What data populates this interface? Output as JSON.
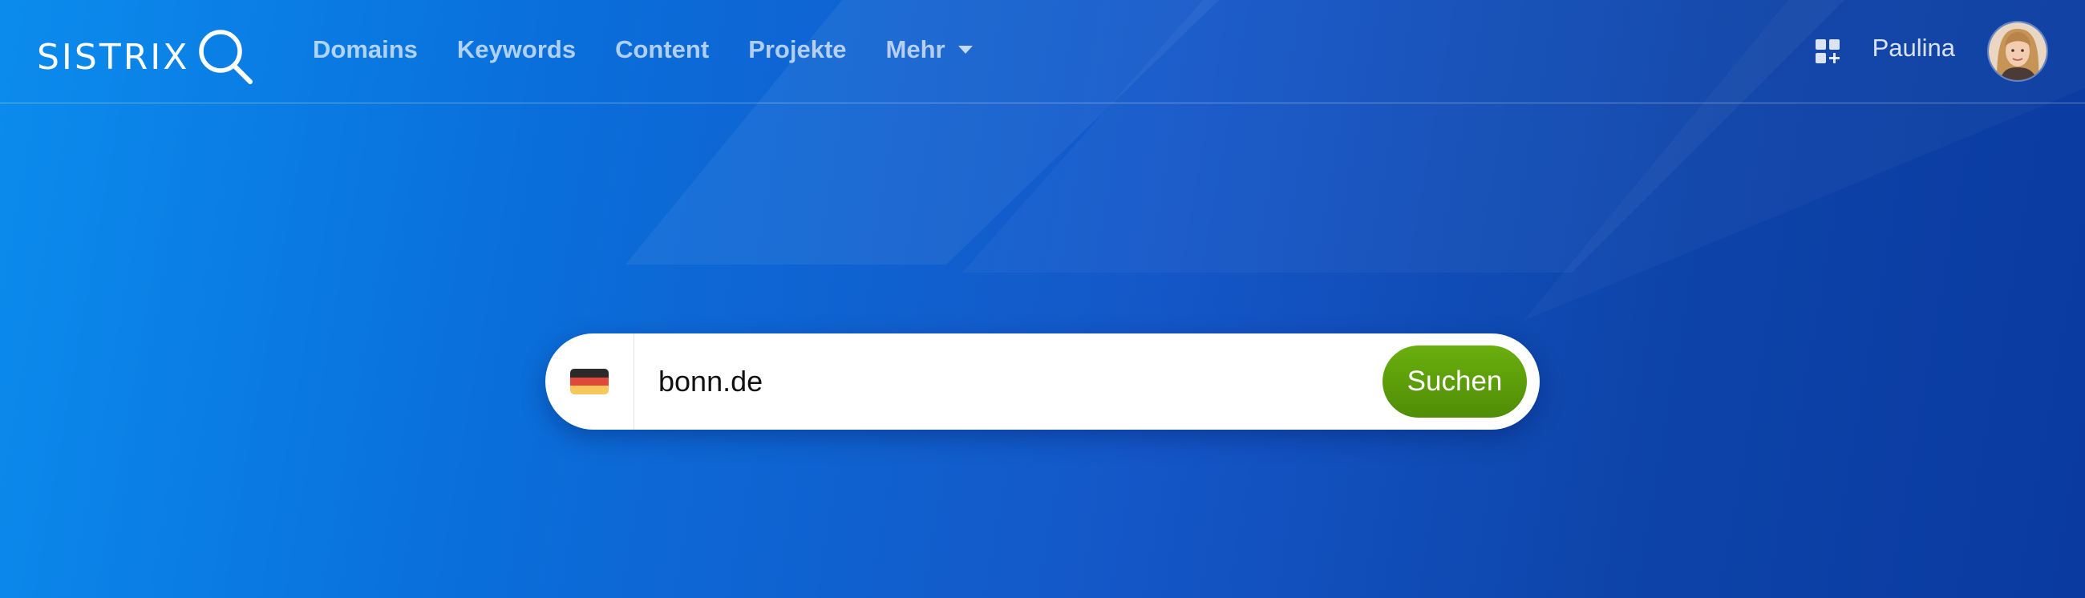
{
  "brand": {
    "logo_text": "SISTRIX",
    "logo_icon": "magnifier-icon"
  },
  "nav": {
    "items": [
      {
        "label": "Domains"
      },
      {
        "label": "Keywords"
      },
      {
        "label": "Content"
      },
      {
        "label": "Projekte"
      },
      {
        "label": "Mehr",
        "icon": "chevron-down-icon"
      }
    ]
  },
  "user": {
    "apps_icon": "apps-grid-icon",
    "name": "Paulina",
    "avatar": "user-avatar"
  },
  "search": {
    "country": "Deutschland",
    "country_icon": "german-flag-icon",
    "query": "bonn.de",
    "button_label": "Suchen"
  },
  "colors": {
    "background_start": "#0b8ced",
    "background_end": "#0a3aa0",
    "button_green": "#5a9c0a",
    "flag_black": "#2a2a2a",
    "flag_red": "#e0483a",
    "flag_gold": "#f6c75a"
  }
}
